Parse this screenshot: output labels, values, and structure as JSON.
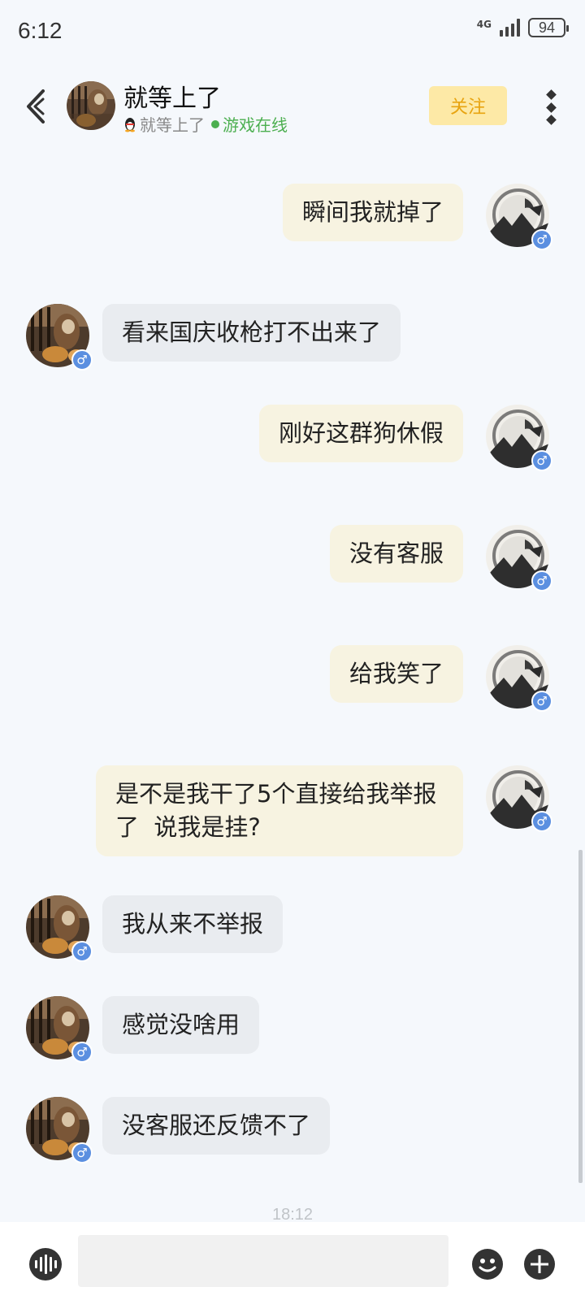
{
  "status_bar": {
    "time": "6:12",
    "network": "4G",
    "battery": "94"
  },
  "header": {
    "name": "就等上了",
    "sub_name": "就等上了",
    "status": "游戏在线",
    "follow_label": "关注"
  },
  "messages": [
    {
      "side": "mine",
      "text": "瞬间我就掉了"
    },
    {
      "side": "theirs",
      "text": "看来国庆收枪打不出来了"
    },
    {
      "side": "mine",
      "text": "刚好这群狗休假"
    },
    {
      "side": "mine",
      "text": "没有客服"
    },
    {
      "side": "mine",
      "text": "给我笑了"
    },
    {
      "side": "mine",
      "text": "是不是我干了5个直接给我举报了  说我是挂?"
    },
    {
      "side": "theirs",
      "text": "我从来不举报"
    },
    {
      "side": "theirs",
      "text": "感觉没啥用"
    },
    {
      "side": "theirs",
      "text": "没客服还反馈不了"
    }
  ],
  "gender_symbol": "♂",
  "timestamp": "18:12",
  "input": {
    "value": "",
    "placeholder": ""
  }
}
